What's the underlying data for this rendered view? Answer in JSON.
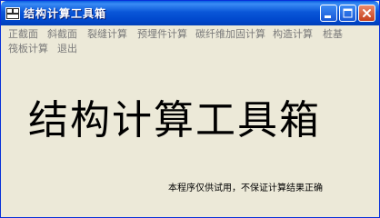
{
  "window": {
    "title": "结构计算工具箱",
    "accent_color": "#0a5fe0",
    "controls": {
      "minimize": "minimize-icon",
      "maximize": "maximize-icon",
      "close": "close-icon"
    }
  },
  "menu": {
    "items": [
      {
        "label": "正截面"
      },
      {
        "label": "斜截面"
      },
      {
        "label": "裂缝计算"
      },
      {
        "label": "预埋件计算"
      },
      {
        "label": "碳纤维加固计算"
      },
      {
        "label": "构造计算"
      },
      {
        "label": "桩基"
      },
      {
        "label": "筏板计算"
      },
      {
        "label": "退出"
      }
    ]
  },
  "main": {
    "title": "结构计算工具箱",
    "disclaimer": "本程序仅供试用，不保证计算结果正确"
  }
}
